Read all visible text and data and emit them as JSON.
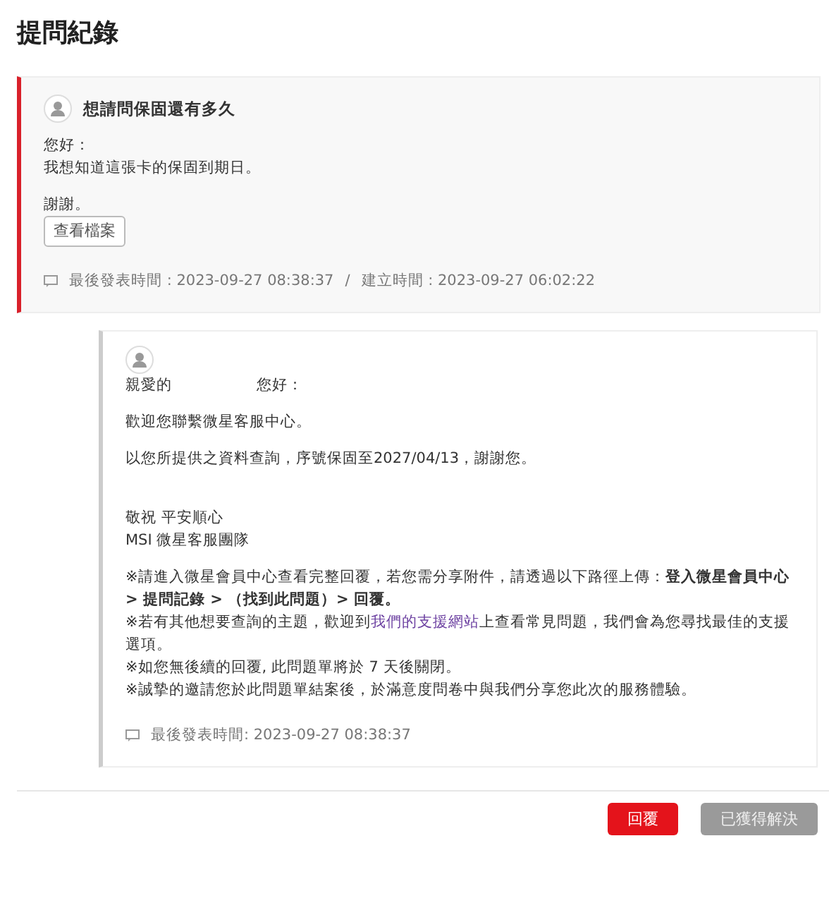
{
  "page_title": "提問紀錄",
  "question": {
    "title": "想請問保固還有多久",
    "paragraphs": [
      [
        "您好：",
        "我想知道這張卡的保固到期日。"
      ],
      [
        "謝謝。"
      ]
    ],
    "attachment_button": "查看檔案",
    "meta": [
      "最後發表時間 : 2023-09-27 08:38:37",
      "/",
      "建立時間 : 2023-09-27 06:02:22"
    ]
  },
  "reply": {
    "greeting": [
      "親愛的",
      "您好："
    ],
    "paragraphs": [
      [
        "歡迎您聯繫微星客服中心。"
      ],
      [
        "以您所提供之資料查詢，序號保固至2027/04/13，謝謝您。"
      ],
      [
        "敬祝 平安順心",
        "MSI 微星客服團隊"
      ]
    ],
    "notes": [
      {
        "kind": "text",
        "text": "※請進入微星會員中心查看完整回覆，若您需分享附件，請透過以下路徑上傳：**登入微星會員中心 > 提問記錄 > （找到此問題）> 回覆。**"
      },
      {
        "kind": "link",
        "before": "※若有其他想要查詢的主題，歡迎到",
        "link": "我們的支援網站",
        "after": "上查看常見問題，我們會為您尋找最佳的支援選項。"
      },
      {
        "kind": "text",
        "text": "※如您無後續的回覆, 此問題單將於 7 天後關閉。"
      },
      {
        "kind": "text",
        "text": "※誠摯的邀請您於此問題單結案後，於滿意度問卷中與我們分享您此次的服務體驗。"
      }
    ],
    "meta": "最後發表時間: 2023-09-27 08:38:37"
  },
  "buttons": [
    {
      "label": "回覆",
      "disabled": false
    },
    {
      "label": "已獲得解決",
      "disabled": true
    }
  ]
}
